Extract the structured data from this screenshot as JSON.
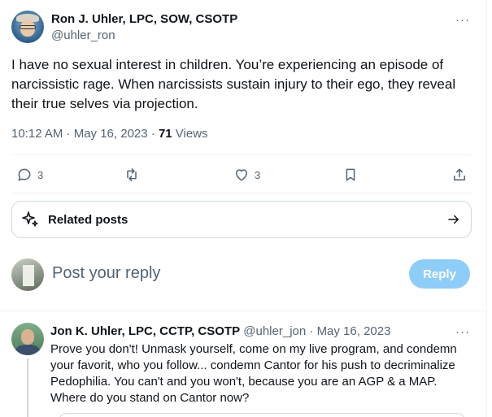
{
  "main_post": {
    "author_name": "Ron J. Uhler, LPC, SOW, CSOTP",
    "handle": "@uhler_ron",
    "more": "···",
    "text": "I have no sexual interest in children. You’re experiencing an episode of narcissistic rage. When narcissists sustain injury to their ego, they reveal their true selves via projection.",
    "time": "10:12 AM · May 16, 2023 · ",
    "views_count": "71",
    "views_label": " Views",
    "actions": {
      "replies": "3",
      "likes": "3"
    }
  },
  "related_posts": {
    "label": "Related posts"
  },
  "reply_composer": {
    "placeholder": "Post your reply",
    "button_label": "Reply"
  },
  "reply_post": {
    "author_name": "Jon K. Uhler, LPC, CCTP, CSOTP",
    "handle": "@uhler_jon",
    "separator": " · ",
    "date": "May 16, 2023",
    "more": "···",
    "text": "Prove you don't! Unmask yourself, come on my live program, and condemn your favorit, who you follow... condemn Cantor for his push to decriminalize Pedophilia. You can't and you won't, because you are an AGP & a MAP. Where do you stand on Cantor now?"
  },
  "colors": {
    "text_primary": "#0f1419",
    "text_secondary": "#536471",
    "border": "#cfd9de",
    "divider": "#eff3f4",
    "reply_button_disabled": "#8ecdf8"
  },
  "icons": [
    "reply-icon",
    "retweet-icon",
    "like-icon",
    "bookmark-icon",
    "share-icon",
    "sparkle-icon",
    "arrow-right-icon",
    "more-icon"
  ]
}
